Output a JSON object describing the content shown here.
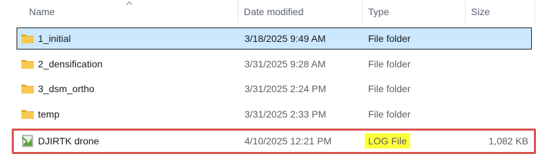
{
  "columns": {
    "name": "Name",
    "date": "Date modified",
    "type": "Type",
    "size": "Size"
  },
  "colors": {
    "selection": "#cce8ff",
    "annotation": "#d9534f",
    "highlight": "#ffff3a",
    "folder": "#f4c03f"
  },
  "rows": [
    {
      "name": "1_initial",
      "date": "3/18/2025 9:49 AM",
      "type": "File folder",
      "size": "",
      "icon": "folder-icon",
      "selected": true
    },
    {
      "name": "2_densification",
      "date": "3/31/2025 9:28 AM",
      "type": "File folder",
      "size": "",
      "icon": "folder-icon"
    },
    {
      "name": "3_dsm_ortho",
      "date": "3/31/2025 2:24 PM",
      "type": "File folder",
      "size": "",
      "icon": "folder-icon"
    },
    {
      "name": "temp",
      "date": "3/31/2025 2:33 PM",
      "type": "File folder",
      "size": "",
      "icon": "folder-icon"
    },
    {
      "name": "DJIRTK drone",
      "date": "4/10/2025 12:21 PM",
      "type": "LOG File",
      "size": "1,082 KB",
      "icon": "log-file-icon",
      "highlighted_type": true
    }
  ]
}
